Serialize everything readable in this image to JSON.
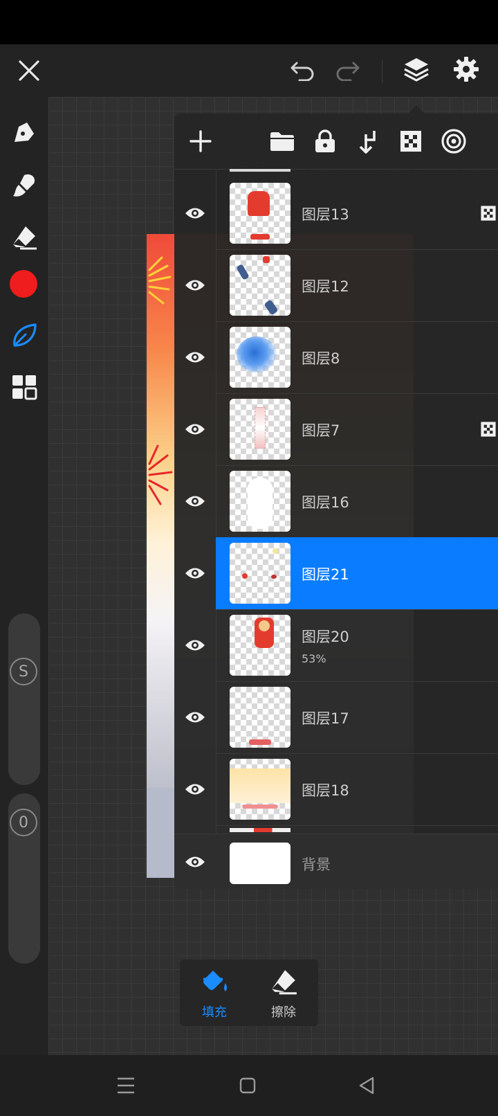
{
  "top_bar": {
    "close": "close-icon",
    "undo": "undo-icon",
    "redo": "redo-icon",
    "layers": "layers-icon",
    "settings": "gear-icon"
  },
  "left_tools": [
    "pen-icon",
    "brush-icon",
    "eraser-icon",
    "color-swatch",
    "leaf-icon",
    "grid-icon"
  ],
  "current_color": "#ef1d1d",
  "accent_color": "#0a7cff",
  "sliders": {
    "size_label": "S",
    "opacity_label": "0"
  },
  "layers_toolbar": [
    "add-icon",
    "folder-icon",
    "lock-icon",
    "merge-down-icon",
    "checker-icon",
    "target-icon"
  ],
  "layers": [
    {
      "name": "图层13",
      "opacity": "",
      "selected": false,
      "mask": true
    },
    {
      "name": "图层12",
      "opacity": "",
      "selected": false,
      "mask": false
    },
    {
      "name": "图层8",
      "opacity": "",
      "selected": false,
      "mask": false
    },
    {
      "name": "图层7",
      "opacity": "",
      "selected": false,
      "mask": true
    },
    {
      "name": "图层16",
      "opacity": "",
      "selected": false,
      "mask": false
    },
    {
      "name": "图层21",
      "opacity": "",
      "selected": true,
      "mask": false
    },
    {
      "name": "图层20",
      "opacity": "53%",
      "selected": false,
      "mask": false
    },
    {
      "name": "图层17",
      "opacity": "",
      "selected": false,
      "mask": false
    },
    {
      "name": "图层18",
      "opacity": "",
      "selected": false,
      "mask": false
    }
  ],
  "background_layer": {
    "name": "背景"
  },
  "tool_popup": {
    "fill_label": "填充",
    "erase_label": "擦除"
  },
  "nav": [
    "menu-icon",
    "home-icon",
    "back-icon"
  ]
}
